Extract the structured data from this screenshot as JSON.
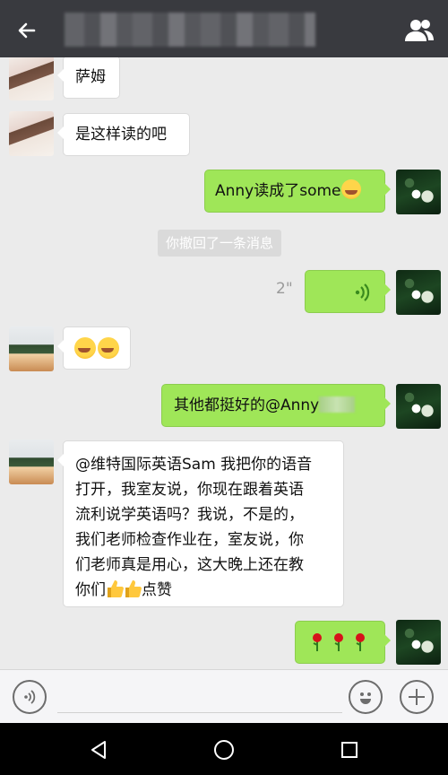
{
  "header": {
    "title": "",
    "back_icon": "arrow-left-icon",
    "group_icon": "group-people-icon"
  },
  "messages": [
    {
      "side": "left",
      "text": "萨姆",
      "avatar": "avatar-girl"
    },
    {
      "side": "left",
      "text": "是这样读的吧",
      "avatar": "avatar-girl"
    },
    {
      "side": "right",
      "text": "Anny读成了some",
      "emoji": "laugh-tears",
      "avatar": "avatar-me"
    },
    {
      "side": "system",
      "text": "你撤回了一条消息"
    },
    {
      "side": "right",
      "type": "voice",
      "duration": "2\"",
      "avatar": "avatar-me"
    },
    {
      "side": "left",
      "type": "emoji",
      "emojis": [
        "laugh-tears",
        "laugh-tears"
      ],
      "avatar": "avatar-girl2"
    },
    {
      "side": "right",
      "text": "其他都挺好的@Anny",
      "avatar": "avatar-me"
    },
    {
      "side": "left",
      "avatar": "avatar-girl2",
      "lines": [
        "@维特国际英语Sam 我把你的语音",
        "打开，我室友说，你现在跟着英语",
        "流利说学英语吗？我说，不是的，",
        "我们老师检查作业在，室友说，你",
        "们老师真是用心，这大晚上还在教",
        "你们"
      ],
      "last_suffix": "点赞"
    },
    {
      "side": "right",
      "type": "roses",
      "count": 3,
      "avatar": "avatar-me"
    }
  ],
  "input": {
    "voice_icon": "voice-mode-icon",
    "emoji_icon": "emoji-face-icon",
    "plus_icon": "plus-icon"
  },
  "navbar": {
    "back_icon": "triangle-back-icon",
    "home_icon": "circle-home-icon",
    "recent_icon": "square-recent-icon"
  },
  "colors": {
    "topbar": "#393a3f",
    "chat_bg": "#ebebeb",
    "bubble_right": "#9fe658",
    "bubble_left": "#ffffff",
    "navbar": "#000000"
  }
}
